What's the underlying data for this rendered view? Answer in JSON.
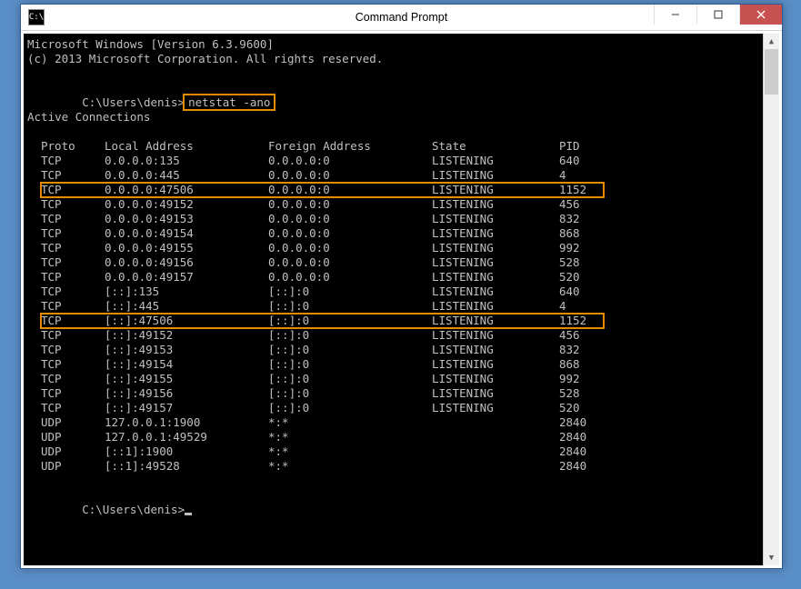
{
  "window": {
    "title": "Command Prompt",
    "icon_label": "C:\\"
  },
  "banner": {
    "line1": "Microsoft Windows [Version 6.3.9600]",
    "line2": "(c) 2013 Microsoft Corporation. All rights reserved."
  },
  "prompt": {
    "path": "C:\\Users\\denis>",
    "command": "netstat -ano"
  },
  "section_title": "Active Connections",
  "columns": {
    "proto": "Proto",
    "local": "Local Address",
    "foreign": "Foreign Address",
    "state": "State",
    "pid": "PID"
  },
  "rows": [
    {
      "proto": "TCP",
      "local": "0.0.0.0:135",
      "foreign": "0.0.0.0:0",
      "state": "LISTENING",
      "pid": "640",
      "hl": false
    },
    {
      "proto": "TCP",
      "local": "0.0.0.0:445",
      "foreign": "0.0.0.0:0",
      "state": "LISTENING",
      "pid": "4",
      "hl": false
    },
    {
      "proto": "TCP",
      "local": "0.0.0.0:47506",
      "foreign": "0.0.0.0:0",
      "state": "LISTENING",
      "pid": "1152",
      "hl": true
    },
    {
      "proto": "TCP",
      "local": "0.0.0.0:49152",
      "foreign": "0.0.0.0:0",
      "state": "LISTENING",
      "pid": "456",
      "hl": false
    },
    {
      "proto": "TCP",
      "local": "0.0.0.0:49153",
      "foreign": "0.0.0.0:0",
      "state": "LISTENING",
      "pid": "832",
      "hl": false
    },
    {
      "proto": "TCP",
      "local": "0.0.0.0:49154",
      "foreign": "0.0.0.0:0",
      "state": "LISTENING",
      "pid": "868",
      "hl": false
    },
    {
      "proto": "TCP",
      "local": "0.0.0.0:49155",
      "foreign": "0.0.0.0:0",
      "state": "LISTENING",
      "pid": "992",
      "hl": false
    },
    {
      "proto": "TCP",
      "local": "0.0.0.0:49156",
      "foreign": "0.0.0.0:0",
      "state": "LISTENING",
      "pid": "528",
      "hl": false
    },
    {
      "proto": "TCP",
      "local": "0.0.0.0:49157",
      "foreign": "0.0.0.0:0",
      "state": "LISTENING",
      "pid": "520",
      "hl": false
    },
    {
      "proto": "TCP",
      "local": "[::]:135",
      "foreign": "[::]:0",
      "state": "LISTENING",
      "pid": "640",
      "hl": false
    },
    {
      "proto": "TCP",
      "local": "[::]:445",
      "foreign": "[::]:0",
      "state": "LISTENING",
      "pid": "4",
      "hl": false
    },
    {
      "proto": "TCP",
      "local": "[::]:47506",
      "foreign": "[::]:0",
      "state": "LISTENING",
      "pid": "1152",
      "hl": true
    },
    {
      "proto": "TCP",
      "local": "[::]:49152",
      "foreign": "[::]:0",
      "state": "LISTENING",
      "pid": "456",
      "hl": false
    },
    {
      "proto": "TCP",
      "local": "[::]:49153",
      "foreign": "[::]:0",
      "state": "LISTENING",
      "pid": "832",
      "hl": false
    },
    {
      "proto": "TCP",
      "local": "[::]:49154",
      "foreign": "[::]:0",
      "state": "LISTENING",
      "pid": "868",
      "hl": false
    },
    {
      "proto": "TCP",
      "local": "[::]:49155",
      "foreign": "[::]:0",
      "state": "LISTENING",
      "pid": "992",
      "hl": false
    },
    {
      "proto": "TCP",
      "local": "[::]:49156",
      "foreign": "[::]:0",
      "state": "LISTENING",
      "pid": "528",
      "hl": false
    },
    {
      "proto": "TCP",
      "local": "[::]:49157",
      "foreign": "[::]:0",
      "state": "LISTENING",
      "pid": "520",
      "hl": false
    },
    {
      "proto": "UDP",
      "local": "127.0.0.1:1900",
      "foreign": "*:*",
      "state": "",
      "pid": "2840",
      "hl": false
    },
    {
      "proto": "UDP",
      "local": "127.0.0.1:49529",
      "foreign": "*:*",
      "state": "",
      "pid": "2840",
      "hl": false
    },
    {
      "proto": "UDP",
      "local": "[::1]:1900",
      "foreign": "*:*",
      "state": "",
      "pid": "2840",
      "hl": false
    },
    {
      "proto": "UDP",
      "local": "[::1]:49528",
      "foreign": "*:*",
      "state": "",
      "pid": "2840",
      "hl": false
    }
  ],
  "prompt2": {
    "path": "C:\\Users\\denis>"
  },
  "highlight_color": "#e68a00"
}
